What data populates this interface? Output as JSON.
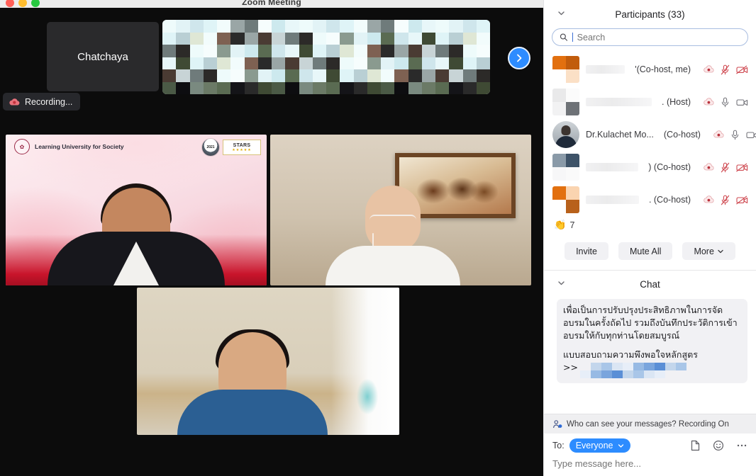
{
  "window": {
    "title": "Zoom Meeting",
    "traffic_lights": [
      "close-red",
      "minimize-yellow",
      "maximize-green"
    ]
  },
  "stage": {
    "name_tile_label": "Chatchaya",
    "next_page_icon": "chevron-right-icon",
    "recording": {
      "label": "Recording...",
      "icon": "cloud-record-icon"
    },
    "virtual_background": {
      "brand_text": "Learning University for Society",
      "seal_icon": "university-seal-icon",
      "badge_year": "2021",
      "badge_stars_label": "STARS",
      "badge_stars_sub": "★★★★★"
    }
  },
  "participants": {
    "header": "Participants (33)",
    "collapse_icon": "chevron-down-icon",
    "search": {
      "placeholder": "Search",
      "value": "",
      "icon": "search-icon"
    },
    "rows": [
      {
        "name": "",
        "role": "'(Co-host, me)",
        "avatar": "blurred-orange",
        "recording": true,
        "mic": "muted",
        "video": "off"
      },
      {
        "name": "",
        "role": ". (Host)",
        "avatar": "blurred-gray",
        "recording": true,
        "mic": "on",
        "video": "on"
      },
      {
        "name": "Dr.Kulachet Mo...",
        "role": "(Co-host)",
        "avatar": "photo",
        "recording": true,
        "mic": "on",
        "video": "on"
      },
      {
        "name": "",
        "role": ") (Co-host)",
        "avatar": "blurred-slate",
        "recording": true,
        "mic": "muted",
        "video": "off"
      },
      {
        "name": "",
        "role": ". (Co-host)",
        "avatar": "blurred-orange2",
        "recording": true,
        "mic": "muted",
        "video": "off"
      }
    ],
    "reaction": {
      "emoji": "clapping-hands-icon",
      "count": "7"
    },
    "buttons": {
      "invite": "Invite",
      "mute_all": "Mute All",
      "more": "More",
      "more_icon": "chevron-down-icon"
    }
  },
  "chat": {
    "header": "Chat",
    "collapse_icon": "chevron-down-icon",
    "message": {
      "paragraph1": "เพื่อเป็นการปรับปรุงประสิทธิภาพในการจัดอบรมในครั้งถัดไป รวมถึงบันทึกประวัติการเข้าอบรมให้กับทุกท่านโดยสมบูรณ์",
      "paragraph2": "แบบสอบถามความพึงพอใจหลักสูตร",
      "link_prefix": ">>",
      "link_blurred": true
    },
    "privacy_notice": "Who can see your messages? Recording On",
    "privacy_icon": "person-lock-icon",
    "to_label": "To:",
    "to_value": "Everyone",
    "to_chevron_icon": "chevron-down-icon",
    "actions": [
      {
        "icon": "file-icon"
      },
      {
        "icon": "emoji-smiley-icon"
      },
      {
        "icon": "more-dots-icon"
      }
    ],
    "input_placeholder": "Type message here..."
  },
  "colors": {
    "accent_blue": "#2d8cff",
    "record_red": "#c9404a",
    "panel_bg": "#ffffff",
    "stage_bg": "#0c0c0c",
    "bubble_bg": "#f1f1f4"
  }
}
